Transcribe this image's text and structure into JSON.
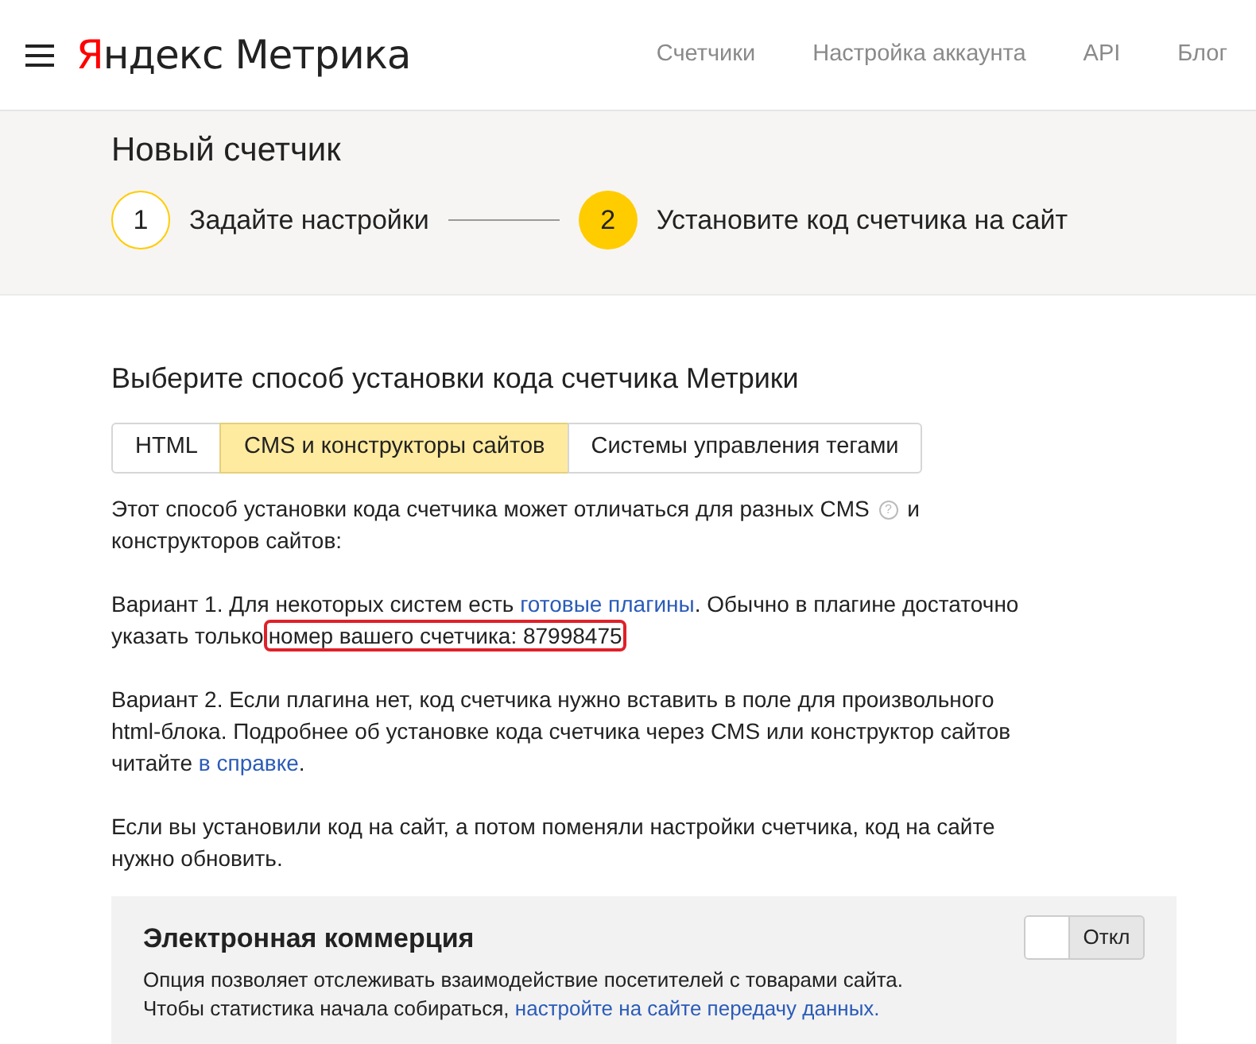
{
  "header": {
    "logo_brand": "Яндекс",
    "logo_product": "Метрика",
    "nav": [
      "Счетчики",
      "Настройка аккаунта",
      "API",
      "Блог"
    ]
  },
  "page_title": "Новый счетчик",
  "steps": [
    {
      "number": "1",
      "label": "Задайте настройки",
      "active": false
    },
    {
      "number": "2",
      "label": "Установите код счетчика на сайт",
      "active": true
    }
  ],
  "section_title": "Выберите способ установки кода счетчика Метрики",
  "tabs": [
    {
      "label": "HTML",
      "selected": false
    },
    {
      "label": "CMS и конструкторы сайтов",
      "selected": true
    },
    {
      "label": "Системы управления тегами",
      "selected": false
    }
  ],
  "paragraphs": [
    {
      "parts": [
        {
          "kind": "text",
          "text": "Этот способ установки кода счетчика может отличаться для разных CMS "
        },
        {
          "kind": "help",
          "text": "?"
        },
        {
          "kind": "text",
          "text": " и конструкторов сайтов:"
        }
      ]
    },
    {
      "parts": [
        {
          "kind": "text",
          "text": "Вариант 1. Для некоторых систем есть "
        },
        {
          "kind": "link",
          "text": "готовые плагины"
        },
        {
          "kind": "text",
          "text": ". Обычно в плагине достаточно указать только"
        },
        {
          "kind": "highlight",
          "text": "номер вашего счетчика: 87998475"
        }
      ]
    },
    {
      "parts": [
        {
          "kind": "text",
          "text": "Вариант 2. Если плагина нет, код счетчика нужно вставить в поле для произвольного html-блока. Подробнее об установке кода счетчика через CMS или конструктор сайтов читайте "
        },
        {
          "kind": "link",
          "text": "в справке"
        },
        {
          "kind": "text",
          "text": "."
        }
      ]
    },
    {
      "parts": [
        {
          "kind": "text",
          "text": "Если вы установили код на сайт, а потом поменяли настройки счетчика, код на сайте нужно обновить."
        }
      ]
    }
  ],
  "ecommerce": {
    "title": "Электронная коммерция",
    "toggle": {
      "on": false,
      "label": "Откл"
    },
    "description": [
      {
        "kind": "text",
        "text": "Опция позволяет отслеживать взаимодействие посетителей с товарами сайта. Чтобы статистика начала собираться, "
      },
      {
        "kind": "link",
        "text": "настройте на сайте передачу данных."
      }
    ]
  }
}
